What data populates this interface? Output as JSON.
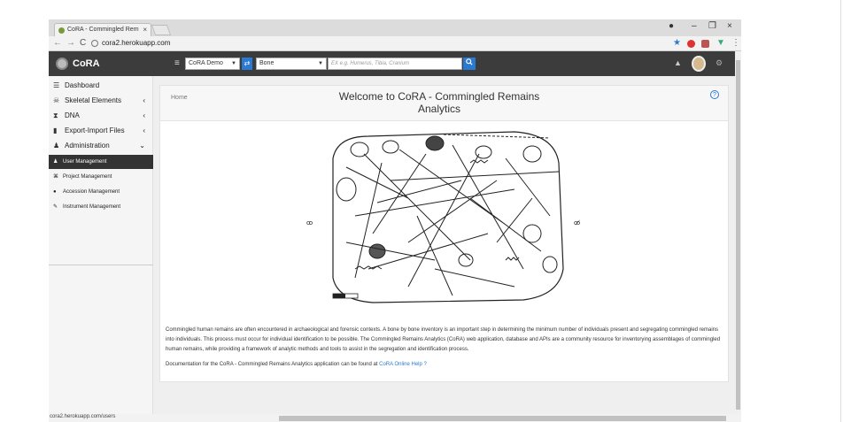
{
  "browser": {
    "tab_title": "CoRA - Commingled Rem",
    "tab_close": "×",
    "url": "cora2.herokuapp.com",
    "status_url": "cora2.herokuapp.com/users",
    "controls": {
      "minimize": "–",
      "restore": "❐",
      "close": "×"
    },
    "nav": {
      "back": "←",
      "forward": "→",
      "reload": "C"
    }
  },
  "header": {
    "brand": "CoRA",
    "project_select": "CoRA Demo",
    "type_select": "Bone",
    "search_placeholder": "EX e.g. Humerus, Tibia, Cranium",
    "menu_icon": "≡",
    "swap_icon": "⇄",
    "search_icon": "🔍",
    "bell_icon": "🔔",
    "settings_icon": "⚙"
  },
  "sidebar": {
    "items": [
      {
        "label": "Dashboard",
        "icon": "☰",
        "chevron": ""
      },
      {
        "label": "Skeletal Elements",
        "icon": "☠",
        "chevron": "‹"
      },
      {
        "label": "DNA",
        "icon": "⧗",
        "chevron": "‹"
      },
      {
        "label": "Export-Import Files",
        "icon": "▮",
        "chevron": "‹"
      },
      {
        "label": "Administration",
        "icon": "♟",
        "chevron": "⌄"
      }
    ],
    "sub_items": [
      {
        "label": "User Management",
        "icon": "♟"
      },
      {
        "label": "Project Management",
        "icon": "⌘"
      },
      {
        "label": "Accession Management",
        "icon": "●"
      },
      {
        "label": "Instrument Management",
        "icon": "✎"
      }
    ]
  },
  "main": {
    "breadcrumb": "Home",
    "title": "Welcome to CoRA - Commingled Remains Analytics",
    "help_icon": "?",
    "paragraph1": "Commingled human remains are often encountered in archaeological and forensic contexts. A bone by bone inventory is an important step in determining the minimum number of individuals present and segregating commingled remains into individuals. This process must occur for individual identification to be possible. The Commingled Remains Analytics (CoRA) web application, database and APIs are a community resource for inventorying assemblages of commingled human remains, while providing a framework of analytic methods and tools to assist in the segregation and identification process.",
    "paragraph2_text": "Documentation for the CoRA - Commingled Remains Analytics application can be found at ",
    "paragraph2_link": "CoRA Online Help",
    "figure_marks": [
      "ꝏ",
      "ꝏ̸"
    ]
  },
  "colors": {
    "header_bg": "#3c3c3c",
    "accent": "#2a7ad3",
    "active_nav": "#333333"
  }
}
